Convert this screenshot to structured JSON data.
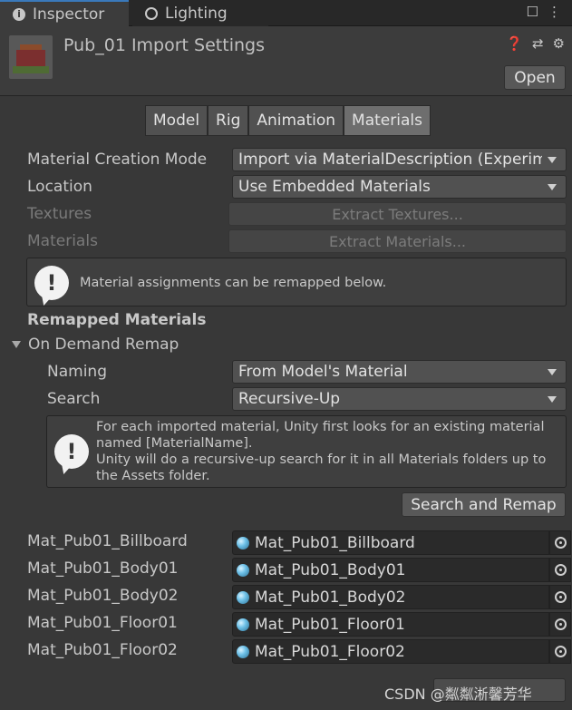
{
  "tabs": {
    "inspector": "Inspector",
    "lighting": "Lighting"
  },
  "header": {
    "title": "Pub_01 Import Settings",
    "open_label": "Open"
  },
  "section_tabs": [
    "Model",
    "Rig",
    "Animation",
    "Materials"
  ],
  "fields": {
    "creation_mode_label": "Material Creation Mode",
    "creation_mode_value": "Import via MaterialDescription (Experimental)",
    "location_label": "Location",
    "location_value": "Use Embedded Materials",
    "textures_label": "Textures",
    "extract_textures": "Extract Textures...",
    "materials_label": "Materials",
    "extract_materials": "Extract Materials..."
  },
  "info1": "Material assignments can be remapped below.",
  "remapped_title": "Remapped Materials",
  "on_demand": "On Demand Remap",
  "naming_label": "Naming",
  "naming_value": "From Model's Material",
  "search_label": "Search",
  "search_value": "Recursive-Up",
  "info2": {
    "line1": "For each imported material, Unity first looks for an existing material",
    "line2": "named [MaterialName].",
    "line3": "Unity will do a recursive-up search for it in all Materials folders up to",
    "line4": "the Assets folder."
  },
  "search_remap": "Search and Remap",
  "materials": [
    {
      "name": "Mat_Pub01_Billboard",
      "value": "Mat_Pub01_Billboard"
    },
    {
      "name": "Mat_Pub01_Body01",
      "value": "Mat_Pub01_Body01"
    },
    {
      "name": "Mat_Pub01_Body02",
      "value": "Mat_Pub01_Body02"
    },
    {
      "name": "Mat_Pub01_Floor01",
      "value": "Mat_Pub01_Floor01"
    },
    {
      "name": "Mat_Pub01_Floor02",
      "value": "Mat_Pub01_Floor02"
    }
  ],
  "watermark": "CSDN @粼粼淅馨芳华",
  "colors": {
    "background": "#383838",
    "tab_accent": "#3a79bb",
    "selected_tab": "#6e6e6e"
  }
}
